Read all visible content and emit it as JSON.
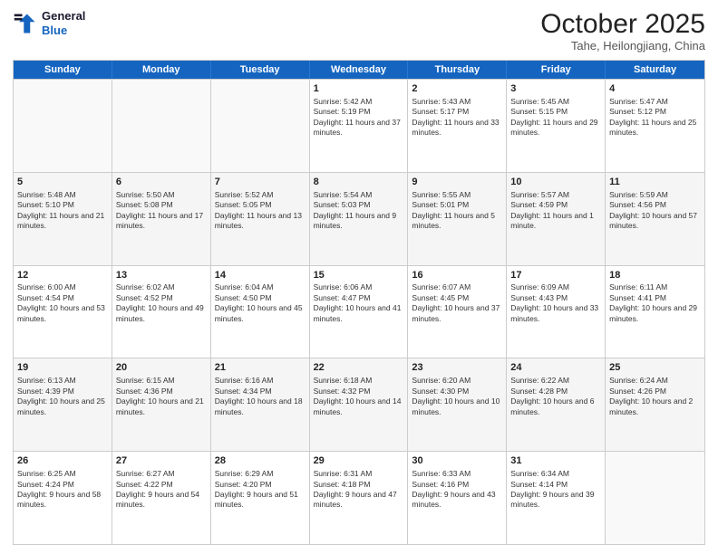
{
  "logo": {
    "line1": "General",
    "line2": "Blue"
  },
  "title": "October 2025",
  "subtitle": "Tahe, Heilongjiang, China",
  "days_of_week": [
    "Sunday",
    "Monday",
    "Tuesday",
    "Wednesday",
    "Thursday",
    "Friday",
    "Saturday"
  ],
  "rows": [
    [
      {
        "day": "",
        "info": ""
      },
      {
        "day": "",
        "info": ""
      },
      {
        "day": "",
        "info": ""
      },
      {
        "day": "1",
        "info": "Sunrise: 5:42 AM\nSunset: 5:19 PM\nDaylight: 11 hours and 37 minutes."
      },
      {
        "day": "2",
        "info": "Sunrise: 5:43 AM\nSunset: 5:17 PM\nDaylight: 11 hours and 33 minutes."
      },
      {
        "day": "3",
        "info": "Sunrise: 5:45 AM\nSunset: 5:15 PM\nDaylight: 11 hours and 29 minutes."
      },
      {
        "day": "4",
        "info": "Sunrise: 5:47 AM\nSunset: 5:12 PM\nDaylight: 11 hours and 25 minutes."
      }
    ],
    [
      {
        "day": "5",
        "info": "Sunrise: 5:48 AM\nSunset: 5:10 PM\nDaylight: 11 hours and 21 minutes."
      },
      {
        "day": "6",
        "info": "Sunrise: 5:50 AM\nSunset: 5:08 PM\nDaylight: 11 hours and 17 minutes."
      },
      {
        "day": "7",
        "info": "Sunrise: 5:52 AM\nSunset: 5:05 PM\nDaylight: 11 hours and 13 minutes."
      },
      {
        "day": "8",
        "info": "Sunrise: 5:54 AM\nSunset: 5:03 PM\nDaylight: 11 hours and 9 minutes."
      },
      {
        "day": "9",
        "info": "Sunrise: 5:55 AM\nSunset: 5:01 PM\nDaylight: 11 hours and 5 minutes."
      },
      {
        "day": "10",
        "info": "Sunrise: 5:57 AM\nSunset: 4:59 PM\nDaylight: 11 hours and 1 minute."
      },
      {
        "day": "11",
        "info": "Sunrise: 5:59 AM\nSunset: 4:56 PM\nDaylight: 10 hours and 57 minutes."
      }
    ],
    [
      {
        "day": "12",
        "info": "Sunrise: 6:00 AM\nSunset: 4:54 PM\nDaylight: 10 hours and 53 minutes."
      },
      {
        "day": "13",
        "info": "Sunrise: 6:02 AM\nSunset: 4:52 PM\nDaylight: 10 hours and 49 minutes."
      },
      {
        "day": "14",
        "info": "Sunrise: 6:04 AM\nSunset: 4:50 PM\nDaylight: 10 hours and 45 minutes."
      },
      {
        "day": "15",
        "info": "Sunrise: 6:06 AM\nSunset: 4:47 PM\nDaylight: 10 hours and 41 minutes."
      },
      {
        "day": "16",
        "info": "Sunrise: 6:07 AM\nSunset: 4:45 PM\nDaylight: 10 hours and 37 minutes."
      },
      {
        "day": "17",
        "info": "Sunrise: 6:09 AM\nSunset: 4:43 PM\nDaylight: 10 hours and 33 minutes."
      },
      {
        "day": "18",
        "info": "Sunrise: 6:11 AM\nSunset: 4:41 PM\nDaylight: 10 hours and 29 minutes."
      }
    ],
    [
      {
        "day": "19",
        "info": "Sunrise: 6:13 AM\nSunset: 4:39 PM\nDaylight: 10 hours and 25 minutes."
      },
      {
        "day": "20",
        "info": "Sunrise: 6:15 AM\nSunset: 4:36 PM\nDaylight: 10 hours and 21 minutes."
      },
      {
        "day": "21",
        "info": "Sunrise: 6:16 AM\nSunset: 4:34 PM\nDaylight: 10 hours and 18 minutes."
      },
      {
        "day": "22",
        "info": "Sunrise: 6:18 AM\nSunset: 4:32 PM\nDaylight: 10 hours and 14 minutes."
      },
      {
        "day": "23",
        "info": "Sunrise: 6:20 AM\nSunset: 4:30 PM\nDaylight: 10 hours and 10 minutes."
      },
      {
        "day": "24",
        "info": "Sunrise: 6:22 AM\nSunset: 4:28 PM\nDaylight: 10 hours and 6 minutes."
      },
      {
        "day": "25",
        "info": "Sunrise: 6:24 AM\nSunset: 4:26 PM\nDaylight: 10 hours and 2 minutes."
      }
    ],
    [
      {
        "day": "26",
        "info": "Sunrise: 6:25 AM\nSunset: 4:24 PM\nDaylight: 9 hours and 58 minutes."
      },
      {
        "day": "27",
        "info": "Sunrise: 6:27 AM\nSunset: 4:22 PM\nDaylight: 9 hours and 54 minutes."
      },
      {
        "day": "28",
        "info": "Sunrise: 6:29 AM\nSunset: 4:20 PM\nDaylight: 9 hours and 51 minutes."
      },
      {
        "day": "29",
        "info": "Sunrise: 6:31 AM\nSunset: 4:18 PM\nDaylight: 9 hours and 47 minutes."
      },
      {
        "day": "30",
        "info": "Sunrise: 6:33 AM\nSunset: 4:16 PM\nDaylight: 9 hours and 43 minutes."
      },
      {
        "day": "31",
        "info": "Sunrise: 6:34 AM\nSunset: 4:14 PM\nDaylight: 9 hours and 39 minutes."
      },
      {
        "day": "",
        "info": ""
      }
    ]
  ]
}
